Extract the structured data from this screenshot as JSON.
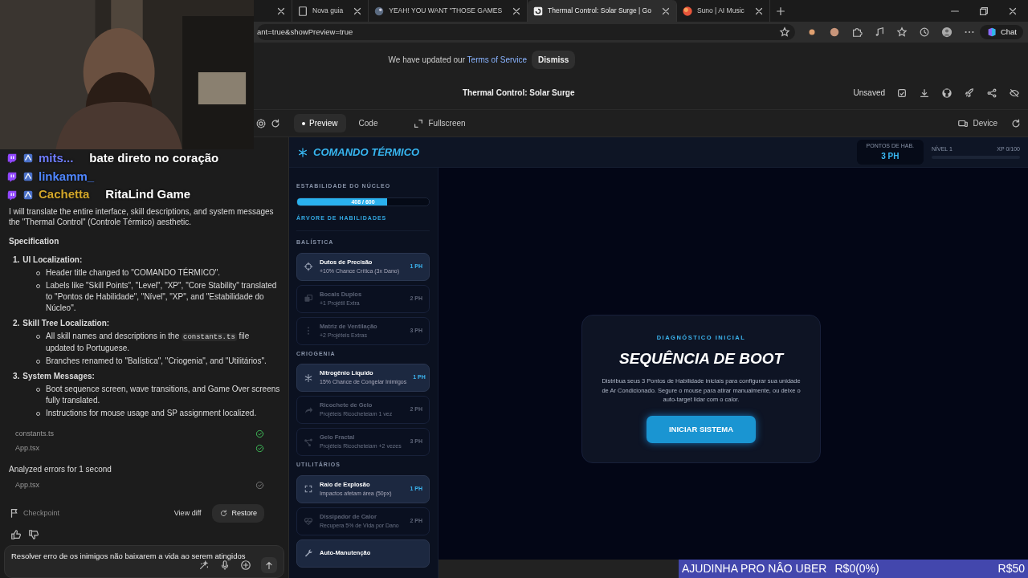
{
  "browser": {
    "tabs": [
      {
        "selected": false
      },
      {
        "label": "Nova guia",
        "selected": false,
        "kind": "page"
      },
      {
        "label": "YEAH! YOU WANT \"THOSE GAMES",
        "selected": false,
        "kind": "game"
      },
      {
        "label": "Thermal Control: Solar Surge | Go",
        "selected": true,
        "kind": "studio"
      },
      {
        "label": "Suno | AI Music",
        "selected": false,
        "kind": "orb"
      }
    ],
    "address": "ant=true&showPreview=true",
    "chat_button": "Chat"
  },
  "banner": {
    "text": "We have updated our ",
    "link": "Terms of Service",
    "button": "Dismiss"
  },
  "header": {
    "title": "Thermal Control: Solar Surge",
    "status": "Unsaved"
  },
  "toolbar": {
    "tabs": [
      {
        "label": "Preview",
        "selected": true
      },
      {
        "label": "Code",
        "selected": false
      }
    ],
    "fullscreen": "Fullscreen",
    "device": "Device"
  },
  "stream_chat": [
    {
      "user": "mits...",
      "color": "#6f7dff",
      "message": "bate direto no coração"
    },
    {
      "user": "linkamm_",
      "color": "#4f86ff"
    },
    {
      "user": "Cachetta",
      "color": "#d2a62a",
      "message": "RitaLind Game"
    }
  ],
  "chat": {
    "intro": [
      "I will translate the entire interface, skill descriptions, and system messages",
      "the \"Thermal Control\" (Controle Térmico) aesthetic."
    ],
    "heading": "Specification",
    "sections": [
      {
        "number": "1.",
        "title": "UI Localization:",
        "bullets": [
          [
            {
              "text": "Header title changed to \"COMANDO TÉRMICO\"."
            }
          ],
          [
            {
              "text": "Labels like \"Skill Points\", \"Level\", \"XP\", \"Core Stability\" translated to \"Pontos de Habilidade\", \"Nível\", \"XP\", and \"Estabilidade do Núcleo\"."
            }
          ]
        ]
      },
      {
        "number": "2.",
        "title": "Skill Tree Localization:",
        "bullets": [
          [
            {
              "text": "All skill names and descriptions in the "
            },
            {
              "code": "constants.ts"
            },
            {
              "text": " file updated to Portuguese."
            }
          ],
          [
            {
              "text": "Branches renamed to \"Balística\", \"Criogenia\", and \"Utilitários\"."
            }
          ]
        ]
      },
      {
        "number": "3.",
        "title": "System Messages:",
        "bullets": [
          [
            {
              "text": "Boot sequence screen, wave transitions, and Game Over screens fully translated."
            }
          ],
          [
            {
              "text": "Instructions for mouse usage and SP assignment localized."
            }
          ]
        ]
      }
    ],
    "files": [
      {
        "name": "constants.ts",
        "completed": true
      },
      {
        "name": "App.tsx",
        "completed": true
      }
    ],
    "analysis": "Analyzed errors for 1 second",
    "analysis_files": [
      {
        "name": "App.tsx",
        "completed": false
      }
    ],
    "checkpoint": "Checkpoint",
    "view_diff": "View diff",
    "restore": "Restore",
    "input": "Resolver erro de os inimigos não baixarem a vida ao serem atingidos"
  },
  "game": {
    "title": "COMANDO TÉRMICO",
    "points_label": "PONTOS DE HAB.",
    "points": "3 PH",
    "xp": {
      "level_label": "NÍVEL 1",
      "text": "XP 0/100",
      "level": 0
    },
    "stability": {
      "label": "ESTABILIDADE DO NÚCLEO",
      "value": "408 / 600",
      "level": 0.68
    },
    "tree_label": "ÁRVORE DE HABILIDADES",
    "branches": [
      {
        "name": "BALÍSTICA",
        "skills": [
          {
            "name": "Dutos de Precisão",
            "desc": "+10% Chance Crítica (3x Dano)",
            "cost": "1 PH",
            "available": true,
            "kind": "crosshair"
          },
          {
            "name": "Bocais Duplos",
            "desc": "+1 Projétil Extra",
            "cost": "2 PH",
            "available": false,
            "kind": "copy"
          },
          {
            "name": "Matriz de Ventilação",
            "desc": "+2 Projéteis Extras",
            "cost": "3 PH",
            "available": false,
            "kind": "dots"
          }
        ]
      },
      {
        "name": "CRIOGENIA",
        "skills": [
          {
            "name": "Nitrogênio Líquido",
            "desc": "15% Chance de Congelar Inimigos",
            "cost": "1 PH",
            "available": true,
            "kind": "snowflake"
          },
          {
            "name": "Ricochete de Gelo",
            "desc": "Projéteis Ricocheteiam 1 vez",
            "cost": "2 PH",
            "available": false,
            "kind": "arrow"
          },
          {
            "name": "Gelo Fractal",
            "desc": "Projéteis Ricocheteiam +2 vezes",
            "cost": "3 PH",
            "available": false,
            "kind": "network"
          }
        ]
      },
      {
        "name": "UTILITÁRIOS",
        "skills": [
          {
            "name": "Raio de Explosão",
            "desc": "Impactos afetam área (50px)",
            "cost": "1 PH",
            "available": true,
            "kind": "expand"
          },
          {
            "name": "Dissipador de Calor",
            "desc": "Recupera 5% de Vida por Dano",
            "cost": "2 PH",
            "available": false,
            "kind": "heart"
          },
          {
            "name": "Auto-Manutenção",
            "available": true,
            "kind": "wrench"
          }
        ]
      }
    ],
    "card": {
      "eyebrow": "DIAGNÓSTICO INICIAL",
      "title": "SEQUÊNCIA DE BOOT",
      "text": "Distribua seus 3 Pontos de Habilidade iniciais para configurar sua unidade de Ar Condicionado. Segure o mouse para atirar manualmente, ou deixe o auto-target lidar com o calor.",
      "button": "INICIAR SISTEMA"
    }
  },
  "donation": {
    "title": "AJUDINHA PRO NÂO UBER",
    "amount": "R$0(0%)",
    "goal": "R$50",
    "level": 0
  }
}
